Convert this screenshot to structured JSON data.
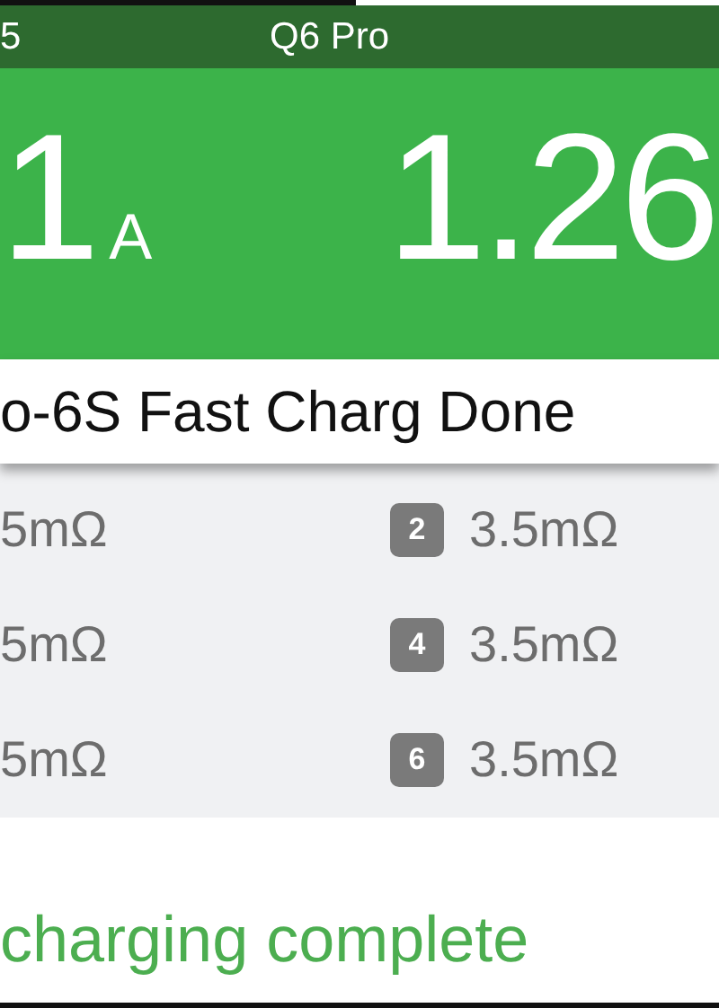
{
  "header": {
    "left_text": "5",
    "title": "Q6 Pro"
  },
  "readings": [
    {
      "value": "1",
      "unit": "A"
    },
    {
      "value": "1.26"
    }
  ],
  "status": "o-6S Fast Charg Done",
  "cells": [
    {
      "value": "5mΩ"
    },
    {
      "badge": "2",
      "value": "3.5mΩ"
    },
    {
      "value": "5mΩ"
    },
    {
      "badge": "4",
      "value": "3.5mΩ"
    },
    {
      "value": "5mΩ"
    },
    {
      "badge": "6",
      "value": "3.5mΩ"
    }
  ],
  "message": "charging complete"
}
